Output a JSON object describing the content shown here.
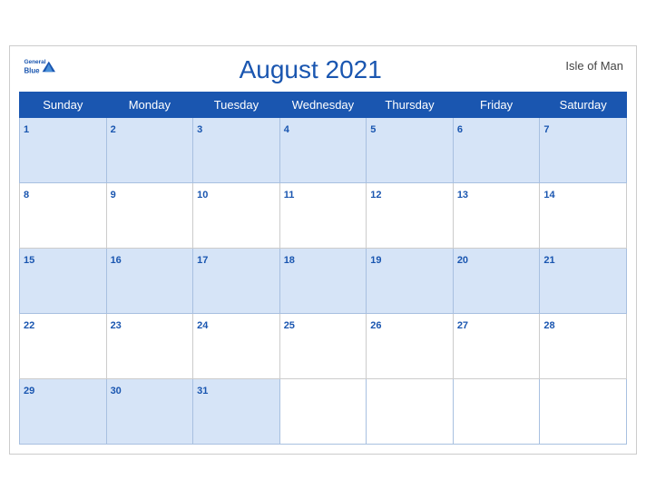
{
  "header": {
    "logo_line1": "General",
    "logo_line2": "Blue",
    "month_title": "August 2021",
    "region": "Isle of Man"
  },
  "weekdays": [
    "Sunday",
    "Monday",
    "Tuesday",
    "Wednesday",
    "Thursday",
    "Friday",
    "Saturday"
  ],
  "weeks": [
    [
      {
        "date": "1",
        "empty": false
      },
      {
        "date": "2",
        "empty": false
      },
      {
        "date": "3",
        "empty": false
      },
      {
        "date": "4",
        "empty": false
      },
      {
        "date": "5",
        "empty": false
      },
      {
        "date": "6",
        "empty": false
      },
      {
        "date": "7",
        "empty": false
      }
    ],
    [
      {
        "date": "8",
        "empty": false
      },
      {
        "date": "9",
        "empty": false
      },
      {
        "date": "10",
        "empty": false
      },
      {
        "date": "11",
        "empty": false
      },
      {
        "date": "12",
        "empty": false
      },
      {
        "date": "13",
        "empty": false
      },
      {
        "date": "14",
        "empty": false
      }
    ],
    [
      {
        "date": "15",
        "empty": false
      },
      {
        "date": "16",
        "empty": false
      },
      {
        "date": "17",
        "empty": false
      },
      {
        "date": "18",
        "empty": false
      },
      {
        "date": "19",
        "empty": false
      },
      {
        "date": "20",
        "empty": false
      },
      {
        "date": "21",
        "empty": false
      }
    ],
    [
      {
        "date": "22",
        "empty": false
      },
      {
        "date": "23",
        "empty": false
      },
      {
        "date": "24",
        "empty": false
      },
      {
        "date": "25",
        "empty": false
      },
      {
        "date": "26",
        "empty": false
      },
      {
        "date": "27",
        "empty": false
      },
      {
        "date": "28",
        "empty": false
      }
    ],
    [
      {
        "date": "29",
        "empty": false
      },
      {
        "date": "30",
        "empty": false
      },
      {
        "date": "31",
        "empty": false
      },
      {
        "date": "",
        "empty": true
      },
      {
        "date": "",
        "empty": true
      },
      {
        "date": "",
        "empty": true
      },
      {
        "date": "",
        "empty": true
      }
    ]
  ],
  "colors": {
    "header_bg": "#1a56b0",
    "row_stripe": "#d6e4f7",
    "white": "#ffffff",
    "date_color": "#1a56b0"
  }
}
